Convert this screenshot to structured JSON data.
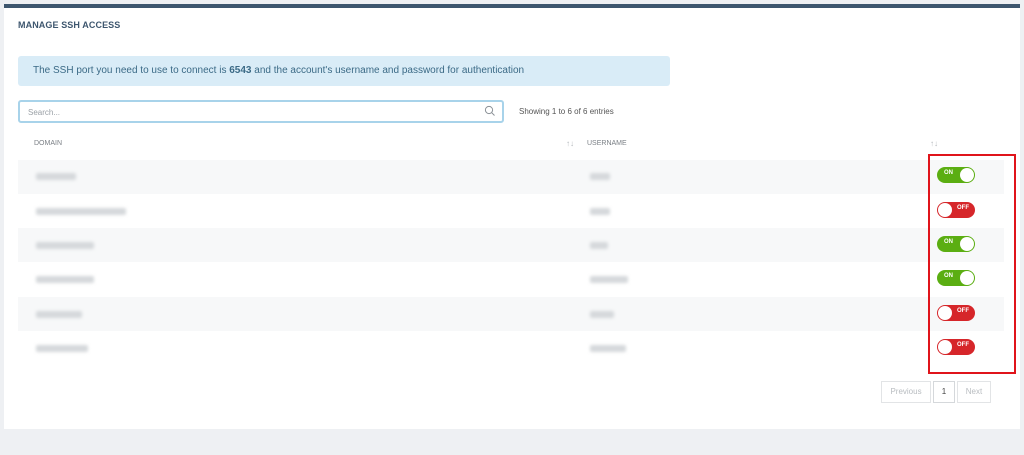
{
  "card": {
    "title": "MANAGE SSH ACCESS"
  },
  "info": {
    "prefix": "The SSH port you need to use to connect is ",
    "port": "6543",
    "suffix": " and the account's username and password for authentication"
  },
  "search": {
    "placeholder": "Search..."
  },
  "entries_text": "Showing 1 to 6 of 6 entries",
  "table": {
    "headers": {
      "domain": "DOMAIN",
      "username": "USERNAME"
    },
    "rows": [
      {
        "status": "ON",
        "state": "on"
      },
      {
        "status": "OFF",
        "state": "off"
      },
      {
        "status": "ON",
        "state": "on"
      },
      {
        "status": "ON",
        "state": "on"
      },
      {
        "status": "OFF",
        "state": "off"
      },
      {
        "status": "OFF",
        "state": "off"
      }
    ]
  },
  "pagination": {
    "previous": "Previous",
    "page": "1",
    "next": "Next"
  },
  "colors": {
    "on": "#5bae12",
    "off": "#d6262a",
    "highlight": "#e0141b",
    "accent": "#3d566e"
  }
}
